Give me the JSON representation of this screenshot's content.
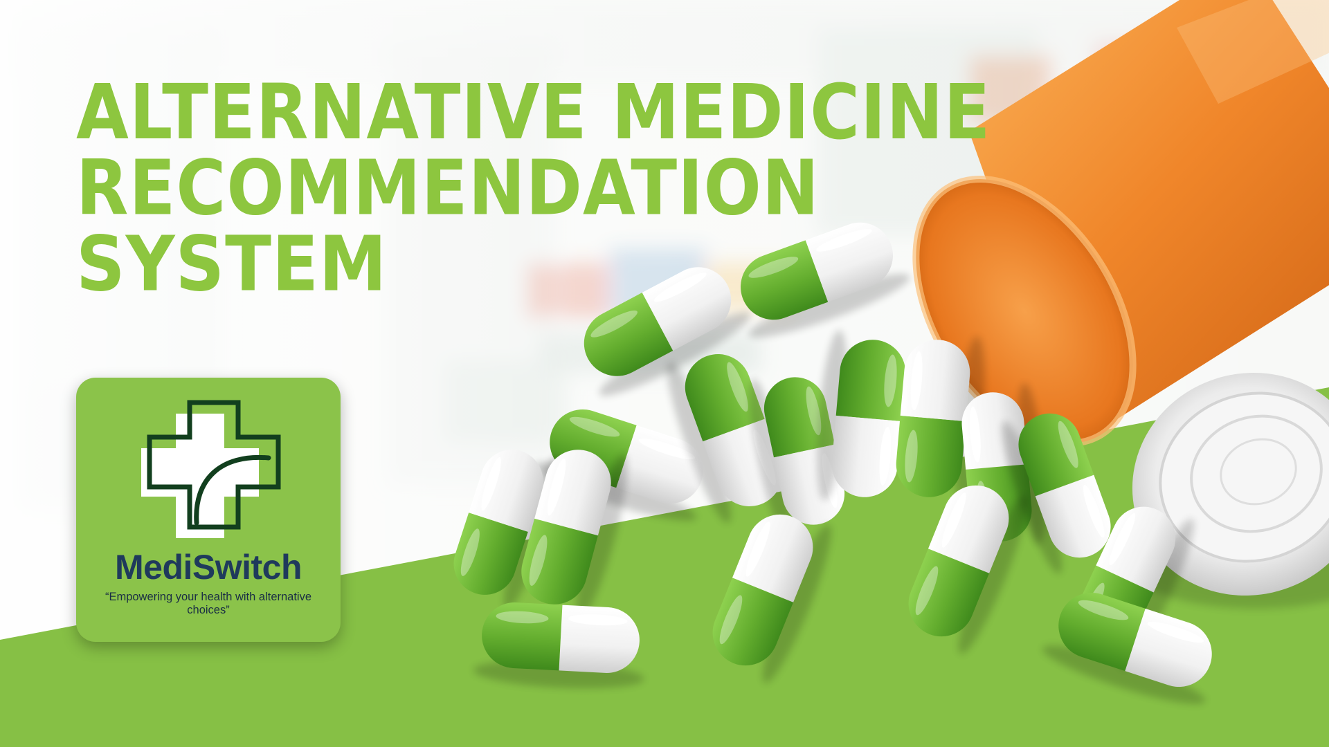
{
  "banner": {
    "title_lines": [
      "ALTERNATIVE MEDICINE",
      "RECOMMENDATION",
      "SYSTEM"
    ]
  },
  "logo": {
    "brand_name": "MediSwitch",
    "tagline": "“Empowering your health with alternative choices”",
    "icon": "medical-cross-icon"
  },
  "colors": {
    "accent_green": "#8dc63f",
    "card_green": "#8bc34a",
    "floor_green": "#86c045",
    "capsule_green": "#6db33f",
    "bottle_orange": "#f08a24",
    "brand_navy": "#1f3a5c",
    "cross_outline": "#123f1e"
  }
}
